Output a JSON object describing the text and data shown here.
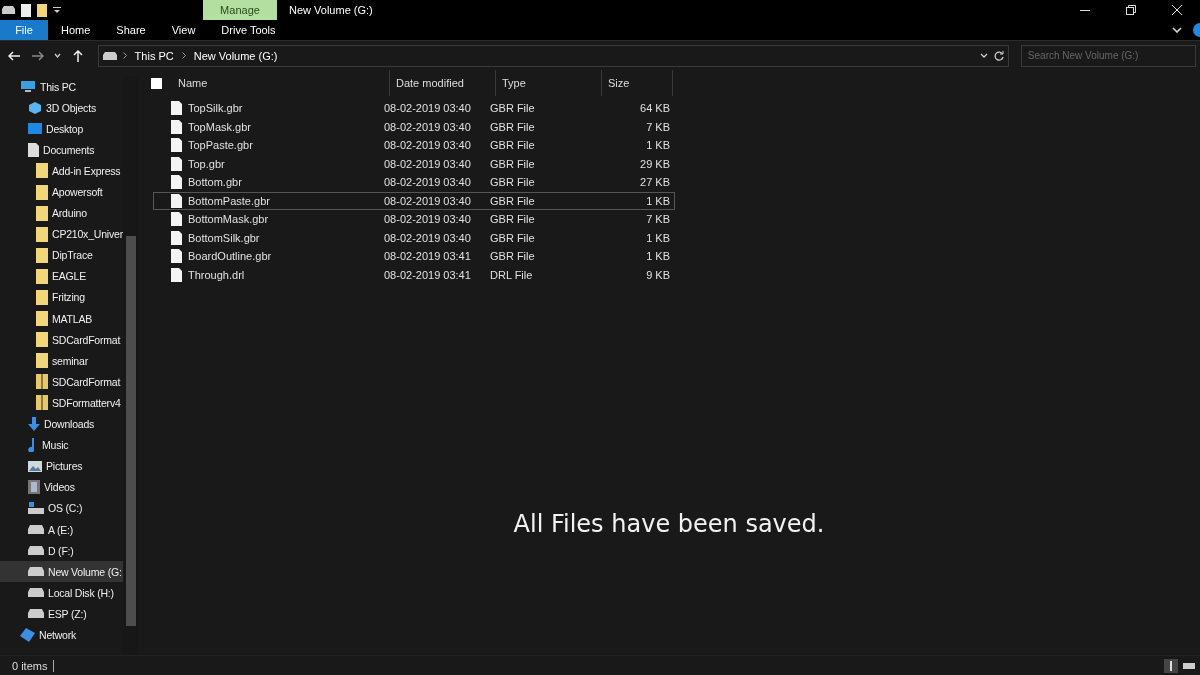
{
  "window": {
    "title": "New Volume (G:)",
    "context_tab": "Manage"
  },
  "ribbon_tabs": [
    {
      "label": "File",
      "selected": true
    },
    {
      "label": "Home",
      "selected": false
    },
    {
      "label": "Share",
      "selected": false
    },
    {
      "label": "View",
      "selected": false
    },
    {
      "label": "Drive Tools",
      "selected": false
    }
  ],
  "address": {
    "path": [
      "This PC",
      "New Volume (G:)"
    ]
  },
  "search": {
    "placeholder": "Search New Volume (G:)"
  },
  "sidebar": {
    "items": [
      {
        "label": "This PC",
        "kind": "pc",
        "selected": false,
        "children": [
          {
            "label": "3D Objects",
            "kind": "objects",
            "selected": false
          },
          {
            "label": "Desktop",
            "kind": "desktop",
            "selected": false
          },
          {
            "label": "Documents",
            "kind": "documents",
            "selected": false,
            "children": [
              {
                "label": "Add-in Express",
                "kind": "folder",
                "selected": false
              },
              {
                "label": "Apowersoft",
                "kind": "folder",
                "selected": false
              },
              {
                "label": "Arduino",
                "kind": "folder",
                "selected": false
              },
              {
                "label": "CP210x_Univer",
                "kind": "folder",
                "selected": false
              },
              {
                "label": "DipTrace",
                "kind": "folder",
                "selected": false
              },
              {
                "label": "EAGLE",
                "kind": "folder",
                "selected": false
              },
              {
                "label": "Fritzing",
                "kind": "folder",
                "selected": false
              },
              {
                "label": "MATLAB",
                "kind": "folder",
                "selected": false
              },
              {
                "label": "SDCardFormat",
                "kind": "folder",
                "selected": false
              },
              {
                "label": "seminar",
                "kind": "folder",
                "selected": false
              },
              {
                "label": "SDCardFormat",
                "kind": "zip",
                "selected": false
              },
              {
                "label": "SDFormatterv4",
                "kind": "zip",
                "selected": false
              }
            ]
          },
          {
            "label": "Downloads",
            "kind": "downloads",
            "selected": false
          },
          {
            "label": "Music",
            "kind": "music",
            "selected": false
          },
          {
            "label": "Pictures",
            "kind": "pictures",
            "selected": false
          },
          {
            "label": "Videos",
            "kind": "videos",
            "selected": false
          },
          {
            "label": "OS (C:)",
            "kind": "osdrive",
            "selected": false
          },
          {
            "label": "A (E:)",
            "kind": "drive",
            "selected": false
          },
          {
            "label": "D (F:)",
            "kind": "drive",
            "selected": false
          },
          {
            "label": "New Volume (G:",
            "kind": "drive",
            "selected": true
          },
          {
            "label": "Local Disk (H:)",
            "kind": "drive",
            "selected": false
          },
          {
            "label": "ESP (Z:)",
            "kind": "drive",
            "selected": false
          }
        ]
      },
      {
        "label": "Network",
        "kind": "network",
        "selected": false
      }
    ]
  },
  "table": {
    "select_all": {
      "checked": false
    },
    "columns": [
      "Name",
      "Date modified",
      "Type",
      "Size"
    ],
    "rows": [
      {
        "name": "TopSilk.gbr",
        "date": "08-02-2019 03:40",
        "type": "GBR File",
        "size": "64 KB",
        "focused": false
      },
      {
        "name": "TopMask.gbr",
        "date": "08-02-2019 03:40",
        "type": "GBR File",
        "size": "7 KB",
        "focused": false
      },
      {
        "name": "TopPaste.gbr",
        "date": "08-02-2019 03:40",
        "type": "GBR File",
        "size": "1 KB",
        "focused": false
      },
      {
        "name": "Top.gbr",
        "date": "08-02-2019 03:40",
        "type": "GBR File",
        "size": "29 KB",
        "focused": false
      },
      {
        "name": "Bottom.gbr",
        "date": "08-02-2019 03:40",
        "type": "GBR File",
        "size": "27 KB",
        "focused": false
      },
      {
        "name": "BottomPaste.gbr",
        "date": "08-02-2019 03:40",
        "type": "GBR File",
        "size": "1 KB",
        "focused": true
      },
      {
        "name": "BottomMask.gbr",
        "date": "08-02-2019 03:40",
        "type": "GBR File",
        "size": "7 KB",
        "focused": false
      },
      {
        "name": "BottomSilk.gbr",
        "date": "08-02-2019 03:40",
        "type": "GBR File",
        "size": "1 KB",
        "focused": false
      },
      {
        "name": "BoardOutline.gbr",
        "date": "08-02-2019 03:41",
        "type": "GBR File",
        "size": "1 KB",
        "focused": false
      },
      {
        "name": "Through.drl",
        "date": "08-02-2019 03:41",
        "type": "DRL File",
        "size": "9 KB",
        "focused": false
      }
    ]
  },
  "caption": "All Files have been saved.",
  "status_bar": {
    "count": "0 items"
  }
}
